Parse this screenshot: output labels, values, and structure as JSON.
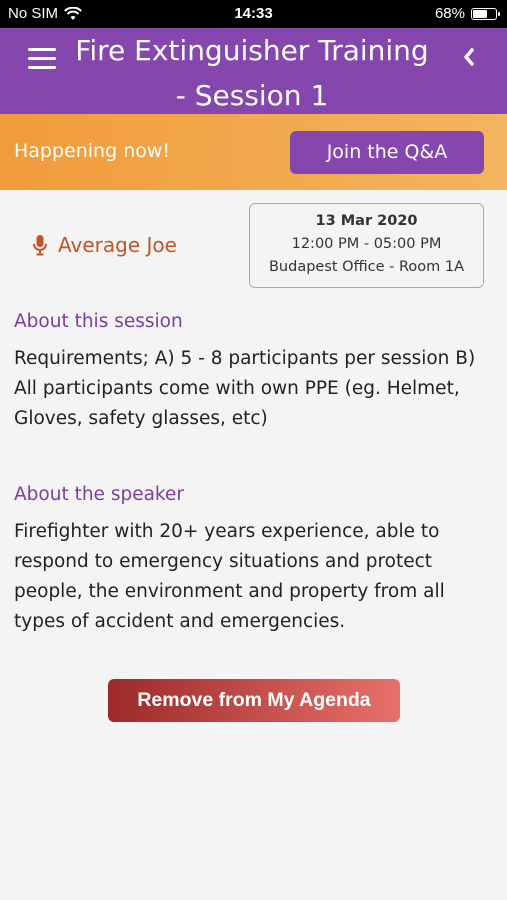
{
  "status_bar": {
    "carrier": "No SIM",
    "time": "14:33",
    "battery_percent": "68%",
    "battery_level": 0.68
  },
  "header": {
    "title_line1": "Fire Extinguisher Training",
    "title_line2": "- Session 1"
  },
  "banner": {
    "text": "Happening now!",
    "qa_button": "Join the Q&A"
  },
  "session": {
    "speaker": "Average Joe",
    "date": "13 Mar 2020",
    "time": "12:00 PM - 05:00 PM",
    "location": "Budapest Office - Room 1A"
  },
  "about_session": {
    "heading": "About this session",
    "body": "Requirements; A) 5 - 8 participants per session B) All participants come with own PPE (eg. Helmet, Gloves, safety glasses, etc)"
  },
  "about_speaker": {
    "heading": "About the speaker",
    "body": "Firefighter with 20+ years experience, able to respond to emergency situations and protect people, the environment and property from all types of accident and emergencies."
  },
  "actions": {
    "remove_button": "Remove from My Agenda"
  },
  "colors": {
    "primary": "#8547ad",
    "banner": "#f19b3a",
    "speaker": "#c0562a",
    "remove_start": "#9c2a2a",
    "remove_end": "#e8706a"
  }
}
